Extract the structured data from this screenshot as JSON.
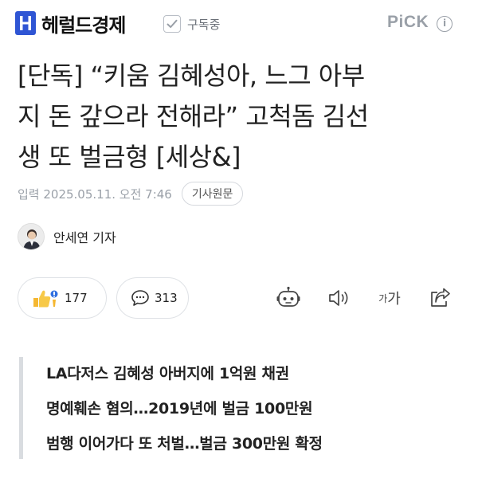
{
  "header": {
    "logo_text": "헤럴드경제",
    "logo_icon": "herald-h-logo-icon",
    "subscribe_label": "구독중",
    "pick_label": "PiCK",
    "info_icon_label": "i",
    "brand_color": "#2f55d4"
  },
  "article": {
    "headline_lines": [
      "[단독] “키움 김혜성아, 느그 아부",
      "지 돈 갚으라 전해라” 고척돔 김선",
      "생 또 벌금형 [세상&]"
    ],
    "date_text": "입력 2025.05.11. 오전 7:46",
    "original_button": "기사원문",
    "reporter": "안세연 기자"
  },
  "actions": {
    "reaction_count": "177",
    "comment_count": "313",
    "font_size_label_small": "가",
    "font_size_label_large": "가"
  },
  "summary": {
    "lines": [
      "LA다저스 김혜성 아버지에 1억원 채권",
      "명예훼손 혐의…2019년에 벌금 100만원",
      "범행 이어가다 또 처벌…벌금 300만원 확정"
    ]
  }
}
